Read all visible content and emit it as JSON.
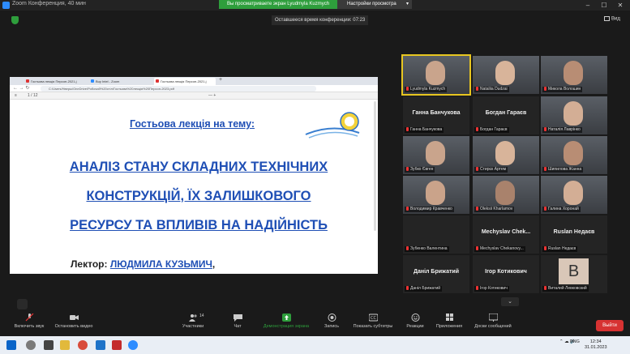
{
  "window": {
    "title": "Zoom Конференция, 40 мин"
  },
  "banner": {
    "viewing": "Вы просматриваете экран Lyudmyla Kuzmych",
    "options": "Настройки просмотра"
  },
  "topbar": {
    "timer": "Оставшееся время конференции: 07:23",
    "view": "Вид"
  },
  "browser": {
    "tabs": [
      "Гостьова лекція Персон-2021.j",
      "Buy Intel - Zoom",
      "Гостьова лекція Персон-2021.j"
    ],
    "address": "C:/Users/Нверы/OneDrive/Робочий%20стіл/Гостьова%20лекція%20Персон-2023.pdf",
    "page_info": "1  /  12"
  },
  "slide": {
    "subtitle": "Гостьова лекція на тему:",
    "title_lines": [
      "АНАЛІЗ СТАНУ СКЛАДНИХ ТЕХНІЧНИХ",
      "КОНСТРУКЦІЙ, ЇХ ЗАЛИШКОВОГО",
      "РЕСУРСУ ТА ВПЛИВІВ НА НАДІЙНІСТЬ"
    ],
    "lecturer_label": "Лектор:",
    "lecturer_name": "ЛЮДМИЛА КУЗЬМИЧ",
    "lecturer_tail": ","
  },
  "participants": [
    {
      "label": "Lyudmyla Kuzmych",
      "big": "",
      "video": true,
      "active": true
    },
    {
      "label": "Nataliia Dudzai",
      "big": "",
      "video": true
    },
    {
      "label": "Микола Волошин",
      "big": "",
      "video": true
    },
    {
      "label": "Ганна Банчукова",
      "big": "Ганна Банчукова",
      "video": false
    },
    {
      "label": "Богдан Гараєв",
      "big": "Богдан Гараєв",
      "video": false
    },
    {
      "label": "Наталія Лаврінко",
      "big": "",
      "video": true
    },
    {
      "label": "Зубко Євген",
      "big": "",
      "video": true
    },
    {
      "label": "Стирєк Артем",
      "big": "",
      "video": true
    },
    {
      "label": "Шипилова Жанна",
      "big": "",
      "video": true
    },
    {
      "label": "Володимир Кравченко",
      "big": "",
      "video": true
    },
    {
      "label": "Oleksii Kharlamov",
      "big": "",
      "video": true
    },
    {
      "label": "Галина Хоронай",
      "big": "",
      "video": true
    },
    {
      "label": "Зубенко Валентина",
      "big": "",
      "video": false
    },
    {
      "label": "Mechyslav Chekanovy...",
      "big": "Mechyslav Chek...",
      "video": false
    },
    {
      "label": "Ruslan Недаєв",
      "big": "Ruslan Недаєв",
      "video": false
    },
    {
      "label": "Даніл Брижатий",
      "big": "Даніл Брижатий",
      "video": false
    },
    {
      "label": "Ігор Котикович",
      "big": "Ігор Котикович",
      "video": false
    },
    {
      "label": "Виталий Левковский",
      "big": "",
      "video": false,
      "avatar": "B"
    }
  ],
  "toolbar": {
    "mute": "Включить звук",
    "video": "Остановить видео",
    "participants": "Участники",
    "participants_count": "14",
    "chat": "Чат",
    "share": "Демонстрация экрана",
    "record": "Запись",
    "captions": "Показать субтитры",
    "reactions": "Реакции",
    "apps": "Приложения",
    "whiteboard": "Доски сообщений",
    "end": "Выйти"
  },
  "taskbar": {
    "lang": "ENG",
    "time": "12:34",
    "date": "31.01.2023"
  },
  "colors": {
    "accent_blue": "#1f4fb5",
    "banner_green": "#2e9e3c",
    "end_red": "#d73232",
    "active_border": "#e8c620"
  }
}
